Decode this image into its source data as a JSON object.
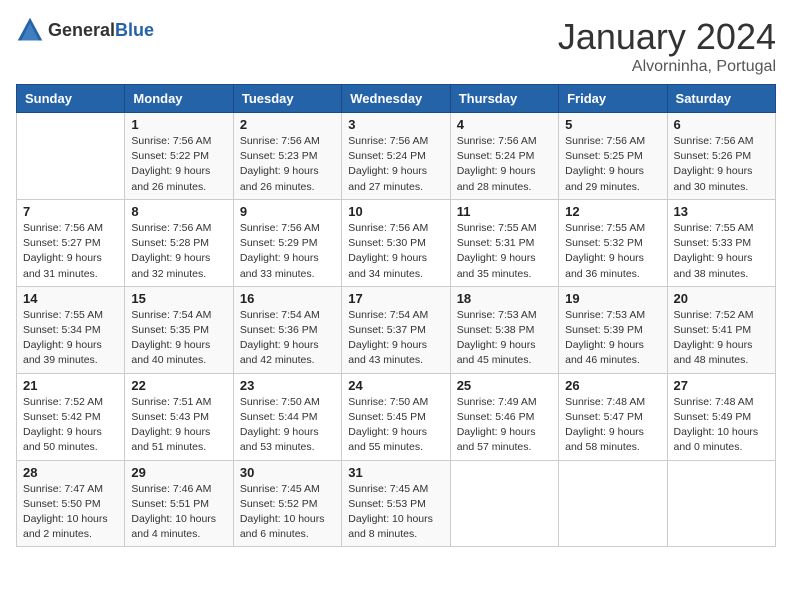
{
  "header": {
    "logo_general": "General",
    "logo_blue": "Blue",
    "title": "January 2024",
    "subtitle": "Alvorninha, Portugal"
  },
  "weekdays": [
    "Sunday",
    "Monday",
    "Tuesday",
    "Wednesday",
    "Thursday",
    "Friday",
    "Saturday"
  ],
  "weeks": [
    [
      {
        "day": "",
        "info": ""
      },
      {
        "day": "1",
        "info": "Sunrise: 7:56 AM\nSunset: 5:22 PM\nDaylight: 9 hours\nand 26 minutes."
      },
      {
        "day": "2",
        "info": "Sunrise: 7:56 AM\nSunset: 5:23 PM\nDaylight: 9 hours\nand 26 minutes."
      },
      {
        "day": "3",
        "info": "Sunrise: 7:56 AM\nSunset: 5:24 PM\nDaylight: 9 hours\nand 27 minutes."
      },
      {
        "day": "4",
        "info": "Sunrise: 7:56 AM\nSunset: 5:24 PM\nDaylight: 9 hours\nand 28 minutes."
      },
      {
        "day": "5",
        "info": "Sunrise: 7:56 AM\nSunset: 5:25 PM\nDaylight: 9 hours\nand 29 minutes."
      },
      {
        "day": "6",
        "info": "Sunrise: 7:56 AM\nSunset: 5:26 PM\nDaylight: 9 hours\nand 30 minutes."
      }
    ],
    [
      {
        "day": "7",
        "info": "Sunrise: 7:56 AM\nSunset: 5:27 PM\nDaylight: 9 hours\nand 31 minutes."
      },
      {
        "day": "8",
        "info": "Sunrise: 7:56 AM\nSunset: 5:28 PM\nDaylight: 9 hours\nand 32 minutes."
      },
      {
        "day": "9",
        "info": "Sunrise: 7:56 AM\nSunset: 5:29 PM\nDaylight: 9 hours\nand 33 minutes."
      },
      {
        "day": "10",
        "info": "Sunrise: 7:56 AM\nSunset: 5:30 PM\nDaylight: 9 hours\nand 34 minutes."
      },
      {
        "day": "11",
        "info": "Sunrise: 7:55 AM\nSunset: 5:31 PM\nDaylight: 9 hours\nand 35 minutes."
      },
      {
        "day": "12",
        "info": "Sunrise: 7:55 AM\nSunset: 5:32 PM\nDaylight: 9 hours\nand 36 minutes."
      },
      {
        "day": "13",
        "info": "Sunrise: 7:55 AM\nSunset: 5:33 PM\nDaylight: 9 hours\nand 38 minutes."
      }
    ],
    [
      {
        "day": "14",
        "info": "Sunrise: 7:55 AM\nSunset: 5:34 PM\nDaylight: 9 hours\nand 39 minutes."
      },
      {
        "day": "15",
        "info": "Sunrise: 7:54 AM\nSunset: 5:35 PM\nDaylight: 9 hours\nand 40 minutes."
      },
      {
        "day": "16",
        "info": "Sunrise: 7:54 AM\nSunset: 5:36 PM\nDaylight: 9 hours\nand 42 minutes."
      },
      {
        "day": "17",
        "info": "Sunrise: 7:54 AM\nSunset: 5:37 PM\nDaylight: 9 hours\nand 43 minutes."
      },
      {
        "day": "18",
        "info": "Sunrise: 7:53 AM\nSunset: 5:38 PM\nDaylight: 9 hours\nand 45 minutes."
      },
      {
        "day": "19",
        "info": "Sunrise: 7:53 AM\nSunset: 5:39 PM\nDaylight: 9 hours\nand 46 minutes."
      },
      {
        "day": "20",
        "info": "Sunrise: 7:52 AM\nSunset: 5:41 PM\nDaylight: 9 hours\nand 48 minutes."
      }
    ],
    [
      {
        "day": "21",
        "info": "Sunrise: 7:52 AM\nSunset: 5:42 PM\nDaylight: 9 hours\nand 50 minutes."
      },
      {
        "day": "22",
        "info": "Sunrise: 7:51 AM\nSunset: 5:43 PM\nDaylight: 9 hours\nand 51 minutes."
      },
      {
        "day": "23",
        "info": "Sunrise: 7:50 AM\nSunset: 5:44 PM\nDaylight: 9 hours\nand 53 minutes."
      },
      {
        "day": "24",
        "info": "Sunrise: 7:50 AM\nSunset: 5:45 PM\nDaylight: 9 hours\nand 55 minutes."
      },
      {
        "day": "25",
        "info": "Sunrise: 7:49 AM\nSunset: 5:46 PM\nDaylight: 9 hours\nand 57 minutes."
      },
      {
        "day": "26",
        "info": "Sunrise: 7:48 AM\nSunset: 5:47 PM\nDaylight: 9 hours\nand 58 minutes."
      },
      {
        "day": "27",
        "info": "Sunrise: 7:48 AM\nSunset: 5:49 PM\nDaylight: 10 hours\nand 0 minutes."
      }
    ],
    [
      {
        "day": "28",
        "info": "Sunrise: 7:47 AM\nSunset: 5:50 PM\nDaylight: 10 hours\nand 2 minutes."
      },
      {
        "day": "29",
        "info": "Sunrise: 7:46 AM\nSunset: 5:51 PM\nDaylight: 10 hours\nand 4 minutes."
      },
      {
        "day": "30",
        "info": "Sunrise: 7:45 AM\nSunset: 5:52 PM\nDaylight: 10 hours\nand 6 minutes."
      },
      {
        "day": "31",
        "info": "Sunrise: 7:45 AM\nSunset: 5:53 PM\nDaylight: 10 hours\nand 8 minutes."
      },
      {
        "day": "",
        "info": ""
      },
      {
        "day": "",
        "info": ""
      },
      {
        "day": "",
        "info": ""
      }
    ]
  ]
}
